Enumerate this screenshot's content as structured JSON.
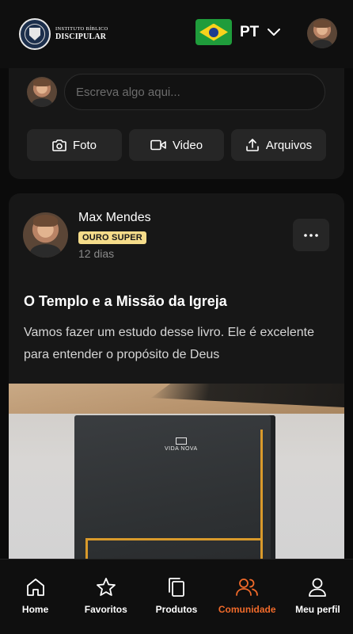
{
  "header": {
    "logo_line1": "INSTITUTO BÍBLICO",
    "logo_line2": "DISCIPULAR",
    "language_code": "PT"
  },
  "composer": {
    "placeholder": "Escreva algo aqui...",
    "buttons": {
      "photo": "Foto",
      "video": "Video",
      "files": "Arquivos"
    }
  },
  "post": {
    "author": "Max Mendes",
    "badge": "OURO SUPER",
    "time": "12 dias",
    "title": "O Templo e a Missão da Igreja",
    "body": "Vamos fazer um estudo desse livro. Ele é excelente para entender o propósito de Deus",
    "image_caption": "VIDA NOVA"
  },
  "nav": {
    "items": [
      {
        "label": "Home",
        "icon": "home-icon"
      },
      {
        "label": "Favoritos",
        "icon": "star-icon"
      },
      {
        "label": "Produtos",
        "icon": "copy-icon"
      },
      {
        "label": "Comunidade",
        "icon": "users-icon"
      },
      {
        "label": "Meu perfil",
        "icon": "user-icon"
      }
    ],
    "active_index": 3
  },
  "colors": {
    "background": "#0b0b0b",
    "card": "#171717",
    "accent": "#f06a2a",
    "badge": "#f5dc8a"
  }
}
